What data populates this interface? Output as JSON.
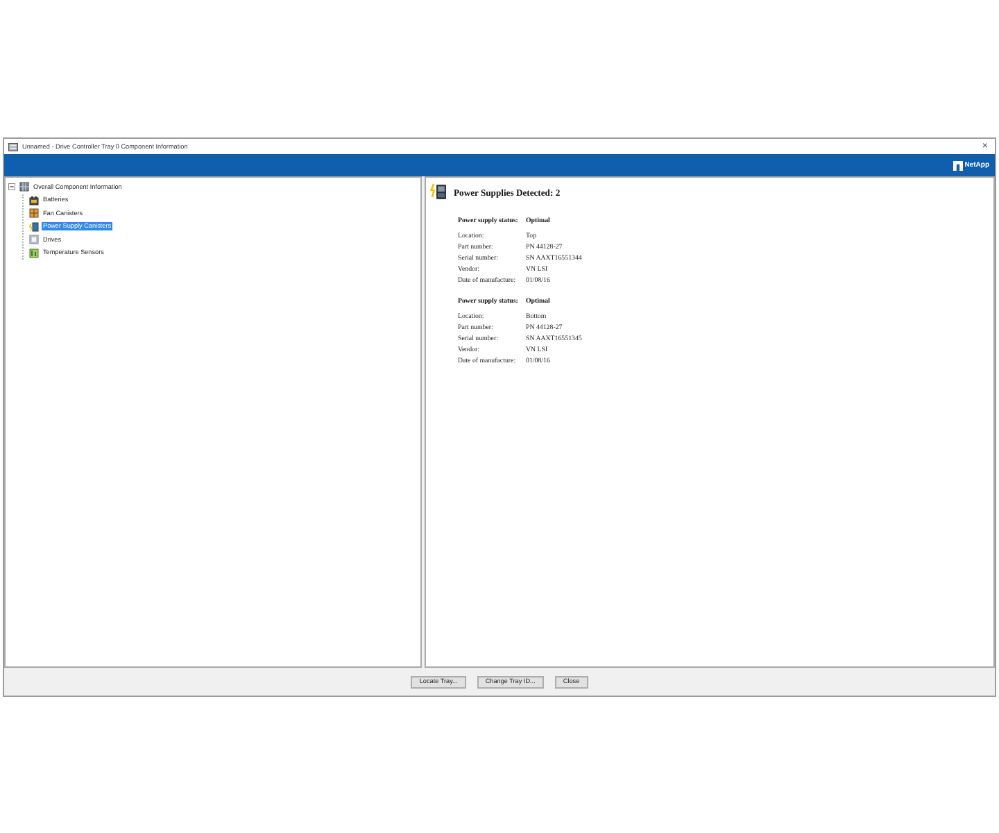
{
  "window": {
    "title": "Unnamed - Drive Controller Tray 0 Component Information",
    "close": "×"
  },
  "banner": {
    "logo": "NetApp"
  },
  "tree": {
    "label": "Overall Component Information",
    "expanded": true,
    "children": [
      {
        "label": "Batteries",
        "kind": "battery",
        "selected": false
      },
      {
        "label": "Fan Canisters",
        "kind": "fan",
        "selected": false
      },
      {
        "label": "Power Supply Canisters",
        "kind": "power",
        "selected": true
      },
      {
        "label": "Drives",
        "kind": "drive",
        "selected": false
      },
      {
        "label": "Temperature Sensors",
        "kind": "temperature",
        "selected": false
      }
    ]
  },
  "details": {
    "title": "Power Supplies Detected: 2",
    "supplies": [
      {
        "status_label": "Power supply status:",
        "status": "Optimal",
        "fields": [
          {
            "label": "Location:",
            "value": "Top"
          },
          {
            "label": "Part number:",
            "value": "PN 44128-27"
          },
          {
            "label": "Serial number:",
            "value": "SN AAXT16551344"
          },
          {
            "label": "Vendor:",
            "value": "VN LSI"
          },
          {
            "label": "Date of manufacture:",
            "value": "01/08/16"
          }
        ]
      },
      {
        "status_label": "Power supply status:",
        "status": "Optimal",
        "fields": [
          {
            "label": "Location:",
            "value": "Bottom"
          },
          {
            "label": "Part number:",
            "value": "PN 44128-27"
          },
          {
            "label": "Serial number:",
            "value": "SN AAXT16551345"
          },
          {
            "label": "Vendor:",
            "value": "VN LSI"
          },
          {
            "label": "Date of manufacture:",
            "value": "01/08/16"
          }
        ]
      }
    ]
  },
  "buttons": [
    "Locate Tray...",
    "Change Tray ID...",
    "Close"
  ]
}
